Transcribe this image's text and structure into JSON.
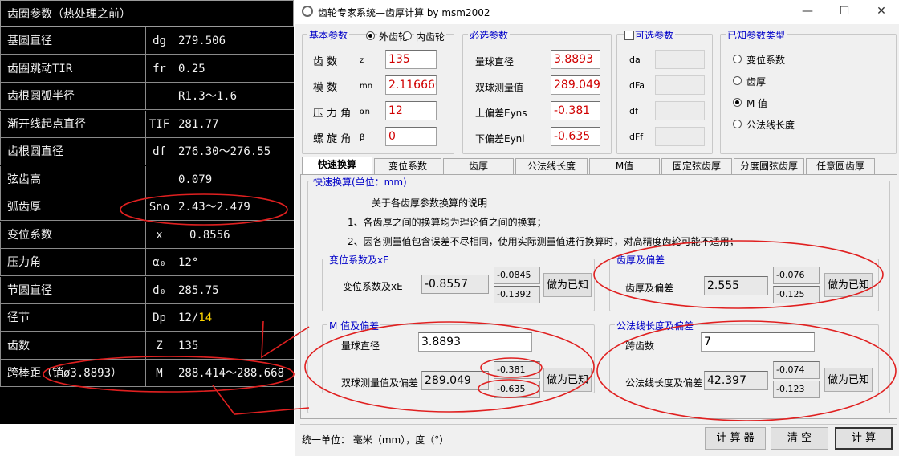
{
  "spec_table": {
    "title": "齿圈参数（热处理之前）",
    "rows": [
      {
        "name": "基圆直径",
        "symbol": "dg",
        "value": "279.506"
      },
      {
        "name": "齿圈跳动TIR",
        "symbol": "fr",
        "value": "0.25"
      },
      {
        "name": "齿根圆弧半径",
        "symbol": "",
        "value": "R1.3～1.6"
      },
      {
        "name": "渐开线起点直径",
        "symbol": "TIF",
        "value": "281.77"
      },
      {
        "name": "齿根圆直径",
        "symbol": "df",
        "value": "276.30～276.55"
      },
      {
        "name": "弦齿高",
        "symbol": "",
        "value": "0.079"
      },
      {
        "name": "弧齿厚",
        "symbol": "Sno",
        "value": "2.43～2.479"
      },
      {
        "name": "变位系数",
        "symbol": "x",
        "value": "－0.8556"
      },
      {
        "name": "压力角",
        "symbol": "α₀",
        "value": "12°"
      },
      {
        "name": "节圆直径",
        "symbol": "d₀",
        "value": "285.75"
      },
      {
        "name": "径节",
        "symbol": "Dp",
        "value": "12/",
        "value_hl": "14"
      },
      {
        "name": "齿数",
        "symbol": "Z",
        "value": "135"
      },
      {
        "name": "跨棒距（销ø3.8893）",
        "symbol": "M",
        "value": "288.414～288.668"
      }
    ]
  },
  "window": {
    "title": "齿轮专家系统—齿厚计算 by msm2002",
    "min": "—",
    "max": "☐",
    "close": "✕"
  },
  "basic": {
    "legend": "基本参数",
    "external": "外齿轮",
    "internal": "内齿轮",
    "fields": [
      {
        "label": "齿    数",
        "sub": "z",
        "value": "135"
      },
      {
        "label": "模    数",
        "sub": "mn",
        "value": "2.116666"
      },
      {
        "label": "压 力 角",
        "sub": "αn",
        "value": "12"
      },
      {
        "label": "螺 旋 角",
        "sub": "β",
        "value": "0"
      }
    ]
  },
  "required": {
    "legend": "必选参数",
    "fields": [
      {
        "label": "量球直径",
        "value": "3.8893"
      },
      {
        "label": "双球测量值",
        "value": "289.049"
      },
      {
        "label": "上偏差Eyns",
        "value": "-0.381"
      },
      {
        "label": "下偏差Eyni",
        "value": "-0.635"
      }
    ]
  },
  "optional": {
    "legend": "可选参数",
    "labels": [
      "da",
      "dFa",
      "df",
      "dFf"
    ]
  },
  "known_type": {
    "legend": "已知参数类型",
    "options": [
      "变位系数",
      "齿厚",
      "M 值",
      "公法线长度"
    ],
    "selected": 2
  },
  "tabs": [
    "快速换算",
    "变位系数",
    "齿厚",
    "公法线长度",
    "M值",
    "固定弦齿厚",
    "分度圆弦齿厚",
    "任意圆齿厚"
  ],
  "panel": {
    "legend": "快速换算(单位：mm)",
    "notes_title": "关于各齿厚参数换算的说明",
    "note1": "1、各齿厚之间的换算均为理论值之间的换算；",
    "note2": "2、因各测量值包含误差不尽相同，使用实际测量值进行换算时，对高精度齿轮可能不适用；",
    "shift": {
      "legend": "变位系数及xE",
      "label": "变位系数及xE",
      "value": "-0.8557",
      "upper": "-0.0845",
      "lower": "-0.1392",
      "button": "做为已知"
    },
    "thickness": {
      "legend": "齿厚及偏差",
      "label": "齿厚及偏差",
      "value": "2.555",
      "upper": "-0.076",
      "lower": "-0.125",
      "button": "做为已知"
    },
    "mvalue": {
      "legend": "M 值及偏差",
      "ball_label": "量球直径",
      "ball_value": "3.8893",
      "label": "双球测量值及偏差",
      "value": "289.049",
      "upper": "-0.381",
      "lower": "-0.635",
      "button": "做为已知"
    },
    "normal": {
      "legend": "公法线长度及偏差",
      "span_label": "跨齿数",
      "span_value": "7",
      "label": "公法线长度及偏差",
      "value": "42.397",
      "upper": "-0.074",
      "lower": "-0.123",
      "button": "做为已知"
    }
  },
  "footer": {
    "units": "统一单位：  毫米（mm），度（°）",
    "calculator": "计 算 器",
    "clear": "清   空",
    "compute": "计  算"
  }
}
